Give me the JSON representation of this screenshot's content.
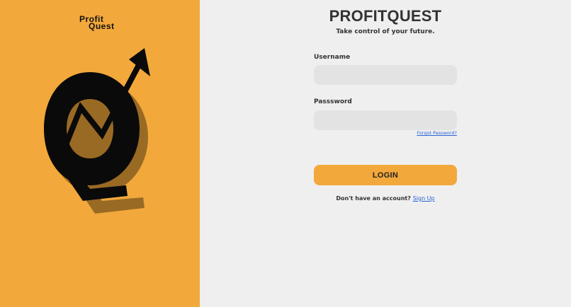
{
  "brand": {
    "logo_line1": "Profit",
    "logo_line2": "Quest",
    "accent_color": "#f2a83b",
    "hero_icon": "q-growth-arrow-icon"
  },
  "header": {
    "title": "PROFITQUEST",
    "tagline": "Take control of your future."
  },
  "form": {
    "username_label": "Username",
    "username_value": "",
    "password_label": "Passsword",
    "password_value": "",
    "forgot_link": "Forgot Password?",
    "login_label": "LOGIN"
  },
  "signup": {
    "prompt": "Don't have an account?",
    "link": "Sign Up",
    "link_color": "#2a63d6"
  }
}
